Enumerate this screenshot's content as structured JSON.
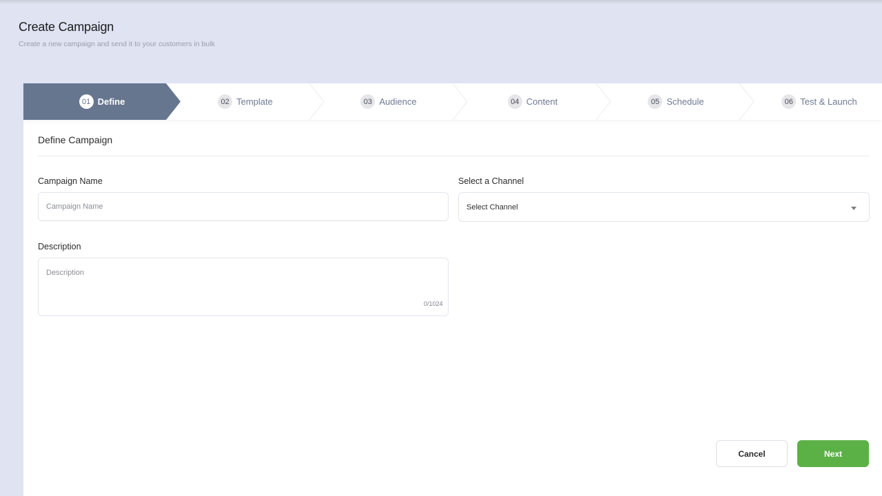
{
  "header": {
    "title": "Create Campaign",
    "subtitle": "Create a new campaign and send it to your customers in bulk"
  },
  "stepper": {
    "active_index": 0,
    "active_color": "#66768f",
    "steps": [
      {
        "number": "01",
        "label": "Define"
      },
      {
        "number": "02",
        "label": "Template"
      },
      {
        "number": "03",
        "label": "Audience"
      },
      {
        "number": "04",
        "label": "Content"
      },
      {
        "number": "05",
        "label": "Schedule"
      },
      {
        "number": "06",
        "label": "Test & Launch"
      }
    ]
  },
  "form": {
    "section_title": "Define Campaign",
    "campaign_name": {
      "label": "Campaign Name",
      "placeholder": "Campaign Name",
      "value": ""
    },
    "channel": {
      "label": "Select a Channel",
      "selected": "Select Channel"
    },
    "description": {
      "label": "Description",
      "placeholder": "Description",
      "value": "",
      "counter": "0/1024"
    }
  },
  "actions": {
    "cancel_label": "Cancel",
    "next_label": "Next",
    "next_color": "#5cb146"
  }
}
